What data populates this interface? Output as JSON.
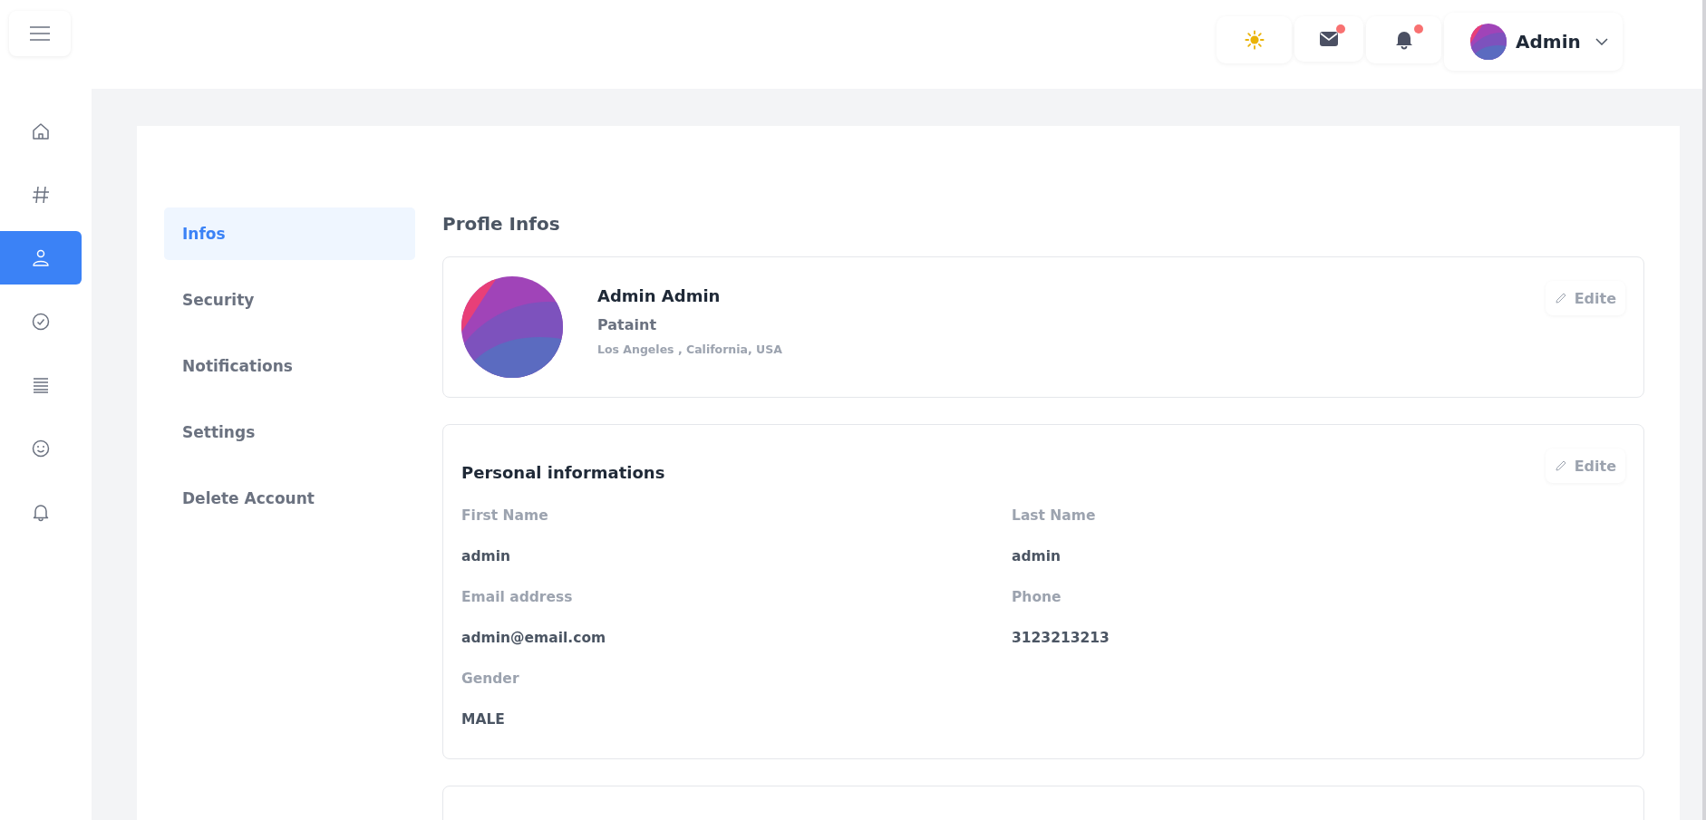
{
  "header": {
    "actions": [
      {
        "kind": "theme",
        "badge": false
      },
      {
        "kind": "mail",
        "badge": true
      },
      {
        "kind": "bell",
        "badge": true
      }
    ],
    "user_menu": {
      "name": "Admin"
    }
  },
  "sidebar": {
    "items": [
      {
        "kind": "home",
        "selected": false
      },
      {
        "kind": "hash",
        "selected": false
      },
      {
        "kind": "user",
        "selected": true
      },
      {
        "kind": "check",
        "selected": false
      },
      {
        "kind": "list",
        "selected": false
      },
      {
        "kind": "smile",
        "selected": false
      },
      {
        "kind": "bell",
        "selected": false
      }
    ]
  },
  "tabs": [
    {
      "label": "Infos",
      "selected": true
    },
    {
      "label": "Security",
      "selected": false
    },
    {
      "label": "Notifications",
      "selected": false
    },
    {
      "label": "Settings",
      "selected": false
    },
    {
      "label": "Delete Account",
      "selected": false
    }
  ],
  "page_title": "Profle Infos",
  "profile_card": {
    "name": "Admin Admin",
    "role": "Pataint",
    "location": "Los Angeles , California, USA",
    "edit_label": "Edite"
  },
  "personal_card": {
    "title": "Personal informations",
    "edit_label": "Edite",
    "fields": [
      {
        "label": "First Name",
        "value": "admin"
      },
      {
        "label": "Last Name",
        "value": "admin"
      },
      {
        "label": "Email address",
        "value": "admin@email.com"
      },
      {
        "label": "Phone",
        "value": "3123213213"
      },
      {
        "label": "Gender",
        "value": "MALE"
      }
    ]
  }
}
